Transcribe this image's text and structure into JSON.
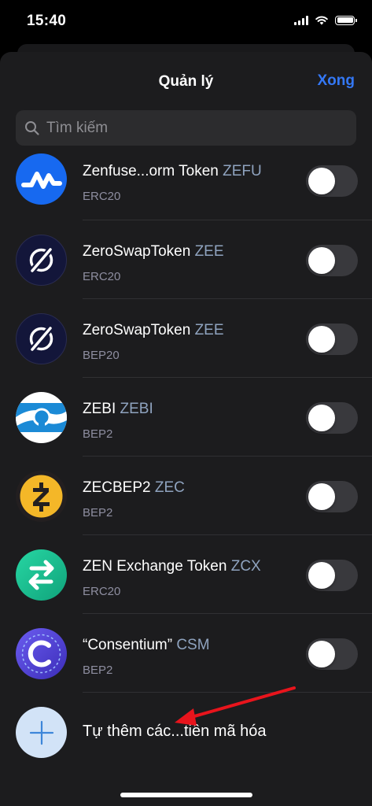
{
  "status_bar": {
    "time": "15:40"
  },
  "header": {
    "title": "Quản lý",
    "done_label": "Xong"
  },
  "search": {
    "placeholder": "Tìm kiếm"
  },
  "tokens": [
    {
      "name": "Zenfuse...orm Token",
      "symbol": "ZEFU",
      "network": "ERC20",
      "icon": "zenfuse-logo",
      "enabled": false
    },
    {
      "name": "ZeroSwapToken",
      "symbol": "ZEE",
      "network": "ERC20",
      "icon": "zeroswap-logo",
      "enabled": false
    },
    {
      "name": "ZeroSwapToken",
      "symbol": "ZEE",
      "network": "BEP20",
      "icon": "zeroswap-logo",
      "enabled": false
    },
    {
      "name": "ZEBI",
      "symbol": "ZEBI",
      "network": "BEP2",
      "icon": "zebi-logo",
      "enabled": false
    },
    {
      "name": "ZECBEP2",
      "symbol": "ZEC",
      "network": "BEP2",
      "icon": "zcash-logo",
      "enabled": false
    },
    {
      "name": "ZEN Exchange Token",
      "symbol": "ZCX",
      "network": "ERC20",
      "icon": "zcx-logo",
      "enabled": false
    },
    {
      "name": "“Consentium”",
      "symbol": "CSM",
      "network": "BEP2",
      "icon": "consentium-logo",
      "enabled": false
    }
  ],
  "add_custom": {
    "label": "Tự thêm các...tiền mã hóa",
    "icon": "plus-icon"
  },
  "colors": {
    "accent": "#3478f6",
    "background": "#1c1c1e",
    "annotation_arrow": "#e8141c"
  }
}
